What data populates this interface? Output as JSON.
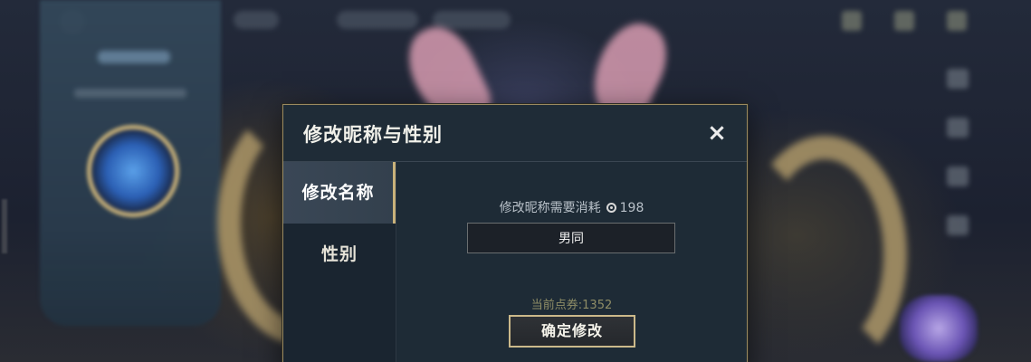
{
  "modal": {
    "title": "修改昵称与性别",
    "close_label": "×",
    "tabs": [
      {
        "label": "修改名称",
        "active": true
      },
      {
        "label": "性别",
        "active": false
      }
    ],
    "cost": {
      "label": "修改昵称需要消耗",
      "icon": "coupon-icon",
      "amount": "198"
    },
    "name_input": {
      "value": "男同"
    },
    "balance_text": "当前点券:1352",
    "confirm_label": "确定修改"
  },
  "colors": {
    "accent_gold": "#cbb98a",
    "modal_bg": "#1e2b36",
    "balance_text": "#8f8d66"
  }
}
